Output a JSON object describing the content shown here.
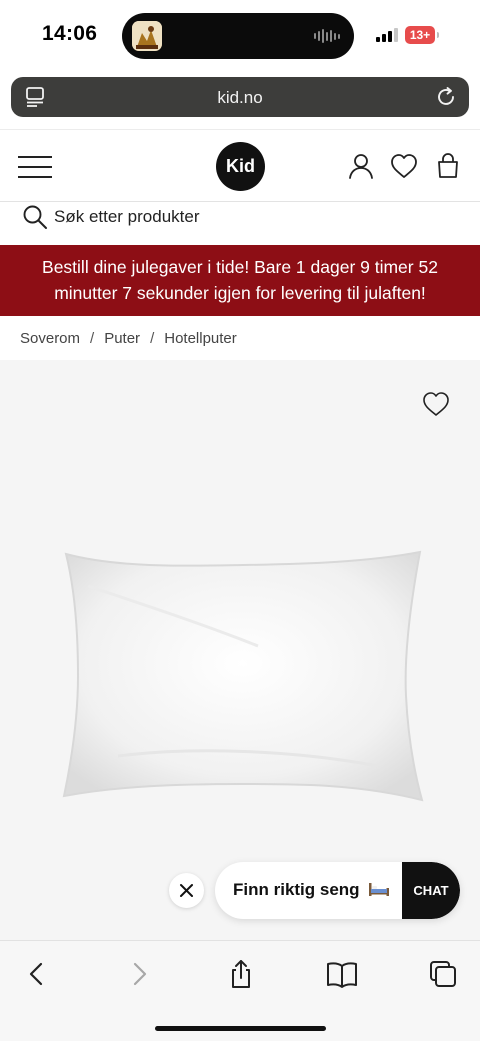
{
  "status_bar": {
    "time": "14:06",
    "battery": "13+",
    "icons": [
      "now-playing-thumbnail",
      "audio-waveform-icon",
      "cellular-signal-icon",
      "battery-icon"
    ]
  },
  "browser": {
    "url": "kid.no",
    "icons": [
      "page-menu-icon",
      "reload-icon"
    ]
  },
  "header": {
    "logo": "Kid",
    "icons": [
      "hamburger-menu-icon",
      "account-icon",
      "wishlist-heart-icon",
      "shopping-bag-icon"
    ]
  },
  "search": {
    "placeholder": "Søk etter produkter"
  },
  "promo": {
    "text": "Bestill dine julegaver i tide! Bare 1 dager 9 timer 52 minutter 7 sekunder igjen for levering til julaften!"
  },
  "breadcrumb": {
    "items": [
      "Soverom",
      "Puter",
      "Hotellputer"
    ],
    "separator": "/"
  },
  "product": {
    "image": "white-pillow",
    "wishlist_icon": "heart-outline-icon"
  },
  "chat": {
    "prompt": "Finn riktig seng",
    "button": "CHAT",
    "icons": [
      "close-icon",
      "bed-emoji-icon"
    ]
  },
  "toolbar": {
    "icons": [
      "back-icon",
      "forward-icon",
      "share-icon",
      "bookmarks-icon",
      "tabs-icon"
    ]
  },
  "colors": {
    "promo_background": "#8d0e15",
    "url_bar": "#3d3d3b",
    "logo": "#111111",
    "chat_button": "#111111"
  }
}
